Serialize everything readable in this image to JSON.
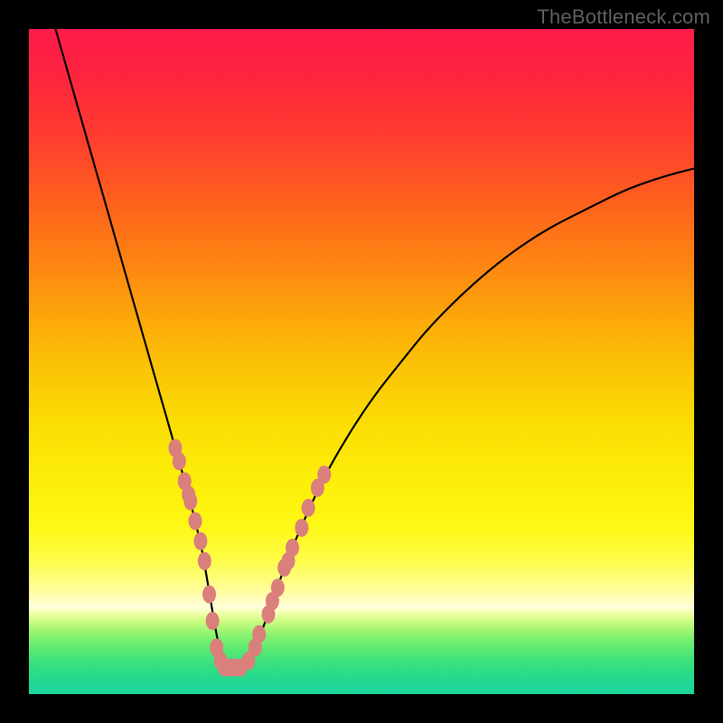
{
  "watermark": {
    "text": "TheBottleneck.com"
  },
  "colors": {
    "frame": "#000000",
    "marker": "#da7f7c",
    "curve": "#000000",
    "gradient_top": "#fe1b4a",
    "gradient_bottom": "#1ed59d"
  },
  "chart_data": {
    "type": "line",
    "title": "",
    "xlabel": "",
    "ylabel": "",
    "xlim": [
      0,
      100
    ],
    "ylim": [
      0,
      100
    ],
    "grid": false,
    "legend": false,
    "series": [
      {
        "name": "bottleneck-curve",
        "x": [
          4,
          6,
          8,
          10,
          12,
          14,
          16,
          18,
          20,
          22,
          24,
          26,
          27,
          28,
          29,
          30,
          32,
          34,
          36,
          38,
          40,
          44,
          48,
          52,
          56,
          60,
          66,
          72,
          78,
          84,
          90,
          96,
          100
        ],
        "y": [
          100,
          93,
          86,
          79,
          72,
          65,
          58,
          51,
          44,
          37,
          30,
          22,
          16,
          10,
          5,
          4,
          4,
          7,
          12,
          18,
          23,
          32,
          39,
          45,
          50,
          55,
          61,
          66,
          70,
          73,
          76,
          78,
          79
        ]
      }
    ],
    "markers": [
      {
        "x": 22.0,
        "y": 37
      },
      {
        "x": 22.6,
        "y": 35
      },
      {
        "x": 23.4,
        "y": 32
      },
      {
        "x": 24.0,
        "y": 30
      },
      {
        "x": 24.3,
        "y": 29
      },
      {
        "x": 25.0,
        "y": 26
      },
      {
        "x": 25.8,
        "y": 23
      },
      {
        "x": 26.4,
        "y": 20
      },
      {
        "x": 27.1,
        "y": 15
      },
      {
        "x": 27.6,
        "y": 11
      },
      {
        "x": 28.2,
        "y": 7
      },
      {
        "x": 28.8,
        "y": 5
      },
      {
        "x": 29.4,
        "y": 4
      },
      {
        "x": 30.2,
        "y": 4
      },
      {
        "x": 31.0,
        "y": 4
      },
      {
        "x": 31.8,
        "y": 4
      },
      {
        "x": 33.0,
        "y": 5
      },
      {
        "x": 34.0,
        "y": 7
      },
      {
        "x": 34.6,
        "y": 9
      },
      {
        "x": 36.0,
        "y": 12
      },
      {
        "x": 36.6,
        "y": 14
      },
      {
        "x": 37.4,
        "y": 16
      },
      {
        "x": 38.4,
        "y": 19
      },
      {
        "x": 39.0,
        "y": 20
      },
      {
        "x": 39.6,
        "y": 22
      },
      {
        "x": 41.0,
        "y": 25
      },
      {
        "x": 42.0,
        "y": 28
      },
      {
        "x": 43.4,
        "y": 31
      },
      {
        "x": 44.4,
        "y": 33
      }
    ],
    "notes": "V-shaped bottleneck curve over a vertical red-to-green gradient background. X and Y axes unlabeled; values estimated in 0–100 normalized space. Minimum near x≈30. Salmon-colored markers cluster along the lower portion of both arms of the V."
  }
}
